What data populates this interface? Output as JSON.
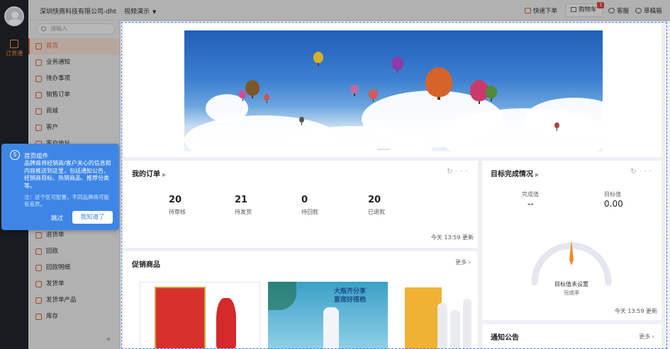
{
  "topbar": {
    "company": "深圳快商科技有限公司-dht",
    "video": "视频演示",
    "quick_order": "快速下单",
    "cart": "购物车",
    "cart_count": "1",
    "service": "客服",
    "menu_btn": "草稿箱"
  },
  "rail": {
    "app_label": "订货通"
  },
  "sidebar": {
    "search_placeholder": "请输入",
    "items": [
      {
        "label": "首页",
        "active": true
      },
      {
        "label": "业务通知"
      },
      {
        "label": "待办事项"
      },
      {
        "label": "销售订单"
      },
      {
        "label": "商城"
      },
      {
        "label": "客户"
      },
      {
        "label": "客户地址"
      },
      {
        "label": "退货单"
      },
      {
        "label": "回款"
      },
      {
        "label": "回款明细"
      },
      {
        "label": "发货单"
      },
      {
        "label": "发货单产品"
      },
      {
        "label": "库存"
      }
    ],
    "collapse": "«"
  },
  "orders": {
    "title": "我的订单",
    "stats": [
      {
        "value": "20",
        "label": "待审核"
      },
      {
        "value": "21",
        "label": "待发货"
      },
      {
        "value": "0",
        "label": "待回款"
      },
      {
        "value": "20",
        "label": "已退款"
      }
    ],
    "updated": "今天 13:59 更新"
  },
  "goal": {
    "title": "目标完成情况",
    "done_label": "完成值",
    "done_value": "--",
    "target_label": "目标值",
    "target_value": "0.00",
    "gauge_text": "目标值未设置",
    "gauge_sub": "完成率",
    "updated": "今天 13:59 更新"
  },
  "promo": {
    "title": "促销商品",
    "more": "更多",
    "p2_line1": "大瓶齐分享",
    "p2_line2": "宴席好搭档"
  },
  "notice": {
    "title": "通知公告",
    "more": "更多"
  },
  "tip": {
    "step": "5",
    "title": "首页组件",
    "body": "品牌商将经销商/客户关心的信息和内容推送到这里，包括通知公告、经销商目标、热销商品、推荐分类等。",
    "note": "注：这个区可配置，不同品牌商可能有差异。",
    "skip": "跳过",
    "ok": "我知道了"
  }
}
